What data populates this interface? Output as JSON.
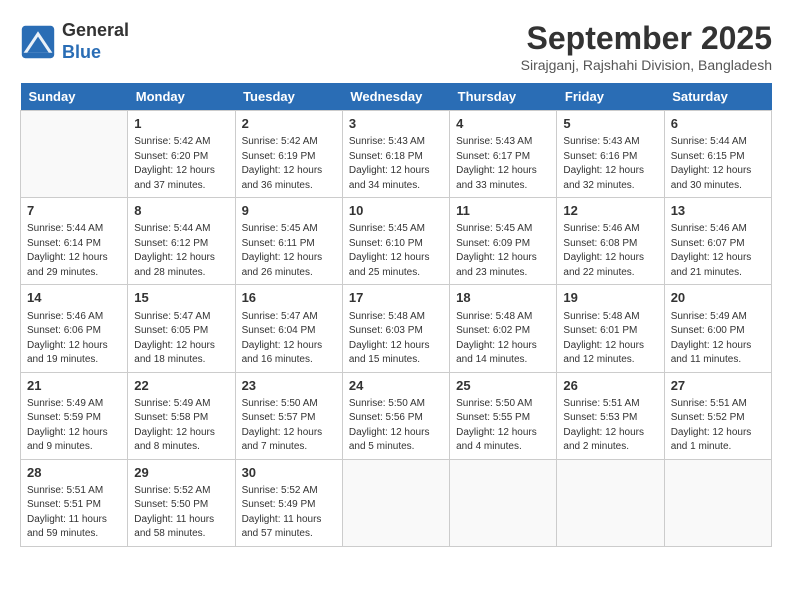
{
  "header": {
    "logo_general": "General",
    "logo_blue": "Blue",
    "month": "September 2025",
    "location": "Sirajganj, Rajshahi Division, Bangladesh"
  },
  "weekdays": [
    "Sunday",
    "Monday",
    "Tuesday",
    "Wednesday",
    "Thursday",
    "Friday",
    "Saturday"
  ],
  "weeks": [
    [
      {
        "day": "",
        "info": ""
      },
      {
        "day": "1",
        "info": "Sunrise: 5:42 AM\nSunset: 6:20 PM\nDaylight: 12 hours\nand 37 minutes."
      },
      {
        "day": "2",
        "info": "Sunrise: 5:42 AM\nSunset: 6:19 PM\nDaylight: 12 hours\nand 36 minutes."
      },
      {
        "day": "3",
        "info": "Sunrise: 5:43 AM\nSunset: 6:18 PM\nDaylight: 12 hours\nand 34 minutes."
      },
      {
        "day": "4",
        "info": "Sunrise: 5:43 AM\nSunset: 6:17 PM\nDaylight: 12 hours\nand 33 minutes."
      },
      {
        "day": "5",
        "info": "Sunrise: 5:43 AM\nSunset: 6:16 PM\nDaylight: 12 hours\nand 32 minutes."
      },
      {
        "day": "6",
        "info": "Sunrise: 5:44 AM\nSunset: 6:15 PM\nDaylight: 12 hours\nand 30 minutes."
      }
    ],
    [
      {
        "day": "7",
        "info": "Sunrise: 5:44 AM\nSunset: 6:14 PM\nDaylight: 12 hours\nand 29 minutes."
      },
      {
        "day": "8",
        "info": "Sunrise: 5:44 AM\nSunset: 6:12 PM\nDaylight: 12 hours\nand 28 minutes."
      },
      {
        "day": "9",
        "info": "Sunrise: 5:45 AM\nSunset: 6:11 PM\nDaylight: 12 hours\nand 26 minutes."
      },
      {
        "day": "10",
        "info": "Sunrise: 5:45 AM\nSunset: 6:10 PM\nDaylight: 12 hours\nand 25 minutes."
      },
      {
        "day": "11",
        "info": "Sunrise: 5:45 AM\nSunset: 6:09 PM\nDaylight: 12 hours\nand 23 minutes."
      },
      {
        "day": "12",
        "info": "Sunrise: 5:46 AM\nSunset: 6:08 PM\nDaylight: 12 hours\nand 22 minutes."
      },
      {
        "day": "13",
        "info": "Sunrise: 5:46 AM\nSunset: 6:07 PM\nDaylight: 12 hours\nand 21 minutes."
      }
    ],
    [
      {
        "day": "14",
        "info": "Sunrise: 5:46 AM\nSunset: 6:06 PM\nDaylight: 12 hours\nand 19 minutes."
      },
      {
        "day": "15",
        "info": "Sunrise: 5:47 AM\nSunset: 6:05 PM\nDaylight: 12 hours\nand 18 minutes."
      },
      {
        "day": "16",
        "info": "Sunrise: 5:47 AM\nSunset: 6:04 PM\nDaylight: 12 hours\nand 16 minutes."
      },
      {
        "day": "17",
        "info": "Sunrise: 5:48 AM\nSunset: 6:03 PM\nDaylight: 12 hours\nand 15 minutes."
      },
      {
        "day": "18",
        "info": "Sunrise: 5:48 AM\nSunset: 6:02 PM\nDaylight: 12 hours\nand 14 minutes."
      },
      {
        "day": "19",
        "info": "Sunrise: 5:48 AM\nSunset: 6:01 PM\nDaylight: 12 hours\nand 12 minutes."
      },
      {
        "day": "20",
        "info": "Sunrise: 5:49 AM\nSunset: 6:00 PM\nDaylight: 12 hours\nand 11 minutes."
      }
    ],
    [
      {
        "day": "21",
        "info": "Sunrise: 5:49 AM\nSunset: 5:59 PM\nDaylight: 12 hours\nand 9 minutes."
      },
      {
        "day": "22",
        "info": "Sunrise: 5:49 AM\nSunset: 5:58 PM\nDaylight: 12 hours\nand 8 minutes."
      },
      {
        "day": "23",
        "info": "Sunrise: 5:50 AM\nSunset: 5:57 PM\nDaylight: 12 hours\nand 7 minutes."
      },
      {
        "day": "24",
        "info": "Sunrise: 5:50 AM\nSunset: 5:56 PM\nDaylight: 12 hours\nand 5 minutes."
      },
      {
        "day": "25",
        "info": "Sunrise: 5:50 AM\nSunset: 5:55 PM\nDaylight: 12 hours\nand 4 minutes."
      },
      {
        "day": "26",
        "info": "Sunrise: 5:51 AM\nSunset: 5:53 PM\nDaylight: 12 hours\nand 2 minutes."
      },
      {
        "day": "27",
        "info": "Sunrise: 5:51 AM\nSunset: 5:52 PM\nDaylight: 12 hours\nand 1 minute."
      }
    ],
    [
      {
        "day": "28",
        "info": "Sunrise: 5:51 AM\nSunset: 5:51 PM\nDaylight: 11 hours\nand 59 minutes."
      },
      {
        "day": "29",
        "info": "Sunrise: 5:52 AM\nSunset: 5:50 PM\nDaylight: 11 hours\nand 58 minutes."
      },
      {
        "day": "30",
        "info": "Sunrise: 5:52 AM\nSunset: 5:49 PM\nDaylight: 11 hours\nand 57 minutes."
      },
      {
        "day": "",
        "info": ""
      },
      {
        "day": "",
        "info": ""
      },
      {
        "day": "",
        "info": ""
      },
      {
        "day": "",
        "info": ""
      }
    ]
  ]
}
